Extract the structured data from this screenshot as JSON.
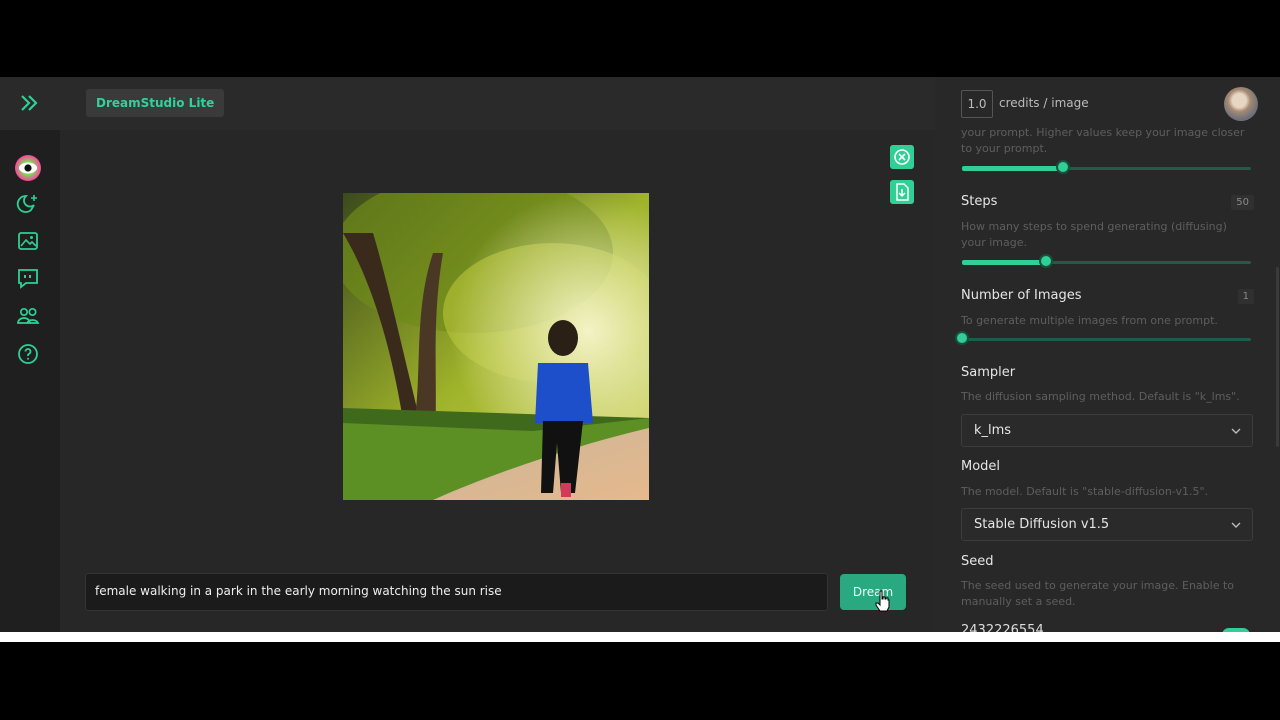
{
  "header": {
    "app_badge": "DreamStudio Lite"
  },
  "sidebar": {
    "items": [
      {
        "icon": "eye-logo-icon",
        "active": true
      },
      {
        "icon": "moon-sparkle-icon"
      },
      {
        "icon": "image-gallery-icon"
      },
      {
        "icon": "chat-quote-icon"
      },
      {
        "icon": "users-icon"
      },
      {
        "icon": "help-circle-icon"
      }
    ]
  },
  "canvas": {
    "image_alt_icon": "generated-image",
    "actions": [
      {
        "icon": "close-circle-icon"
      },
      {
        "icon": "download-file-icon"
      }
    ]
  },
  "prompt": {
    "value": "female walking in a park in the early morning watching the sun rise",
    "button_label": "Dream"
  },
  "settings": {
    "credits_value": "1.0",
    "credits_label": "credits / image",
    "cfg": {
      "desc": "your prompt. Higher values keep your image closer to your prompt.",
      "value_fraction": 0.35
    },
    "steps": {
      "title": "Steps",
      "value": "50",
      "desc": "How many steps to spend generating (diffusing) your image.",
      "value_fraction": 0.29
    },
    "num_images": {
      "title": "Number of Images",
      "value": "1",
      "desc": "To generate multiple images from one prompt.",
      "value_fraction": 0.0
    },
    "sampler": {
      "title": "Sampler",
      "desc": "The diffusion sampling method. Default is \"k_lms\".",
      "selected": "k_lms"
    },
    "model": {
      "title": "Model",
      "desc": "The model. Default is \"stable-diffusion-v1.5\".",
      "selected": "Stable Diffusion v1.5"
    },
    "seed": {
      "title": "Seed",
      "desc": "The seed used to generate your image. Enable to manually set a seed.",
      "value": "2432226554"
    }
  },
  "colors": {
    "accent": "#2fcf96",
    "accent_dark": "#2aa880",
    "panel": "#282828"
  }
}
